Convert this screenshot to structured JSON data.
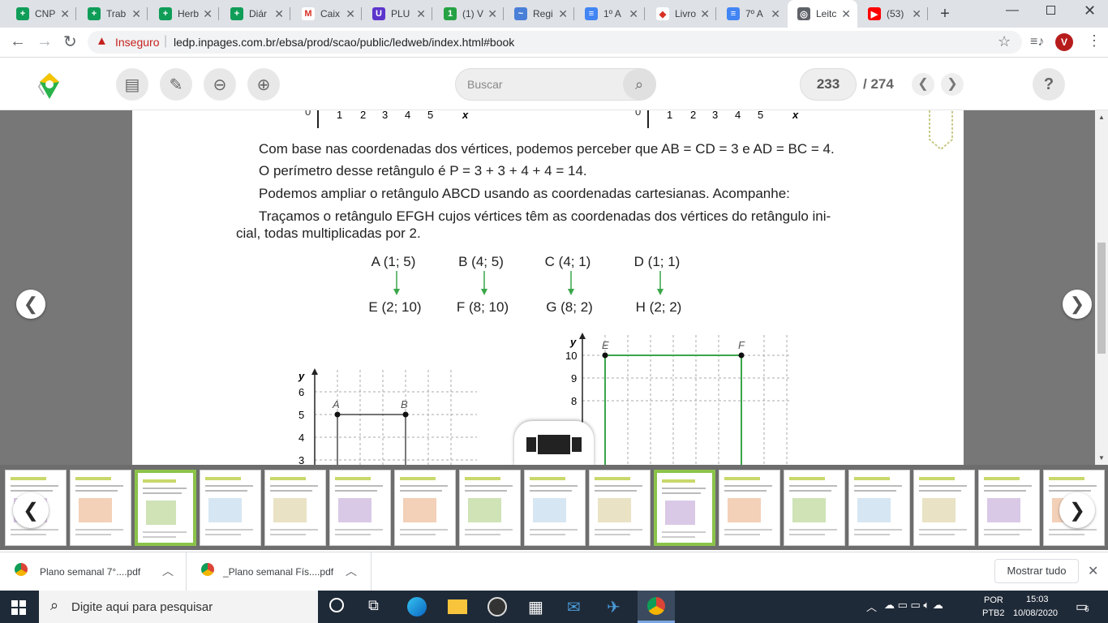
{
  "browser": {
    "tabs": [
      {
        "title": "CNP",
        "color": "#0f9d58",
        "glyph": "+"
      },
      {
        "title": "Trab",
        "color": "#0f9d58",
        "glyph": "+"
      },
      {
        "title": "Herb",
        "color": "#0f9d58",
        "glyph": "+"
      },
      {
        "title": "Diár",
        "color": "#0f9d58",
        "glyph": "+"
      },
      {
        "title": "Caix",
        "color": "#ffffff",
        "glyph": "M"
      },
      {
        "title": "PLU",
        "color": "#5c35cc",
        "glyph": "U"
      },
      {
        "title": "(1) V",
        "color": "#25a244",
        "glyph": "1"
      },
      {
        "title": "Regi",
        "color": "#4a7fd8",
        "glyph": "~"
      },
      {
        "title": "1º A",
        "color": "#4285f4",
        "glyph": "≡"
      },
      {
        "title": "Livro",
        "color": "#ffffff",
        "glyph": "◆"
      },
      {
        "title": "7º A",
        "color": "#4285f4",
        "glyph": "≡"
      },
      {
        "title": "Leitc",
        "color": "#5f6368",
        "glyph": "◎"
      },
      {
        "title": "(53)",
        "color": "#ff0000",
        "glyph": "▶"
      }
    ],
    "insecure_label": "Inseguro",
    "url": "ledp.inpages.com.br/ebsa/prod/scao/public/ledweb/index.html#book",
    "profile_initial": "V"
  },
  "app": {
    "search_placeholder": "Buscar",
    "current_page": "233",
    "total_pages": "/ 274",
    "help": "?"
  },
  "page": {
    "axis_top_left": [
      "0",
      "1",
      "2",
      "3",
      "4",
      "5",
      "x"
    ],
    "axis_top_right": [
      "0",
      "1",
      "2",
      "3",
      "4",
      "5",
      "x"
    ],
    "line1_pre": "Com base nas coordenadas dos vértices, podemos perceber que ",
    "line1_math": "AB = CD = 3 e AD = BC = 4.",
    "line2": "O perímetro desse retângulo é P = 3 + 3 + 4 + 4 = 14.",
    "line3": "Podemos ampliar o retângulo ABCD usando as coordenadas cartesianas. Acompanhe:",
    "line4": "Traçamos o retângulo EFGH cujos vértices têm as coordenadas dos vértices do retângulo ini-",
    "line5": "cial, todas multiplicadas por 2.",
    "mapping": [
      {
        "from": "A (1; 5)",
        "to": "E (2; 10)"
      },
      {
        "from": "B (4; 5)",
        "to": "F (8; 10)"
      },
      {
        "from": "C (4; 1)",
        "to": "G (8; 2)"
      },
      {
        "from": "D (1; 1)",
        "to": "H (2; 2)"
      }
    ],
    "graph_left": {
      "ylabel": "y",
      "ticks": [
        "6",
        "5",
        "4",
        "3"
      ],
      "points": [
        "A",
        "B"
      ]
    },
    "graph_right": {
      "ylabel": "y",
      "ticks": [
        "10",
        "9",
        "8"
      ],
      "points": [
        "E",
        "F"
      ]
    }
  },
  "downloads": {
    "items": [
      "Plano semanal 7°....pdf",
      "_Plano semanal Fís....pdf"
    ],
    "show_all": "Mostrar tudo"
  },
  "taskbar": {
    "search": "Digite aqui para pesquisar",
    "lang1": "POR",
    "lang2": "PTB2",
    "time": "15:03",
    "date": "10/08/2020",
    "notif_count": "6"
  },
  "colors": {
    "accent_green": "#3aa64a",
    "thumb_selected": "#8bc34a"
  }
}
